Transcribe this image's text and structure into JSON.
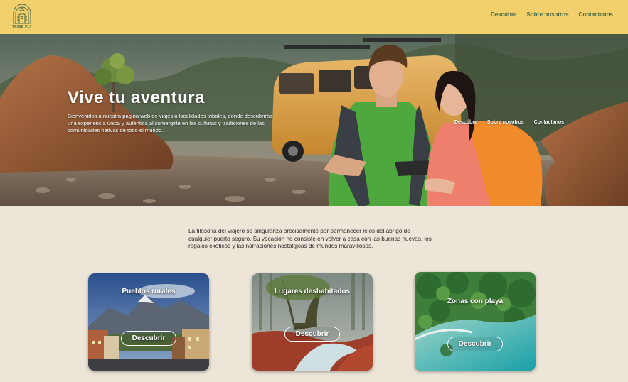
{
  "header": {
    "logo_text": "TRIBE FLY",
    "nav": [
      "Descúbre",
      "Sobre nosotros",
      "Contactanos"
    ]
  },
  "hero": {
    "title": "Vive tu aventura",
    "text": "Bienvenidos a nuestra página web de viajes a localidades tribales, donde descubrirás una experiencia única y auténtica al sumergirte en las culturas y tradiciones de las comunidades nativas de todo el mundo.",
    "nav": [
      "Descúbre",
      "Sobre nosotros",
      "Contactanos"
    ]
  },
  "intro": {
    "text": "La filosofía del viajero se singulariza precisamente por permanecer lejos del abrigo de cualquier puerto seguro. Su vocación no consiste en volver a casa con las buenas nuevas, los regalos exóticos y las narraciones nostálgicas de mundos maravillosos."
  },
  "cards": [
    {
      "title": "Pueblos rurales",
      "button": "Descubrir"
    },
    {
      "title": "Lugares deshabitados",
      "button": "Descubrir"
    },
    {
      "title": "Zonas con playa",
      "button": "Descubrir"
    }
  ],
  "colors": {
    "header_bg": "#f2d06b",
    "nav_text": "#4a6b4d",
    "page_bg": "#ece5d8"
  }
}
